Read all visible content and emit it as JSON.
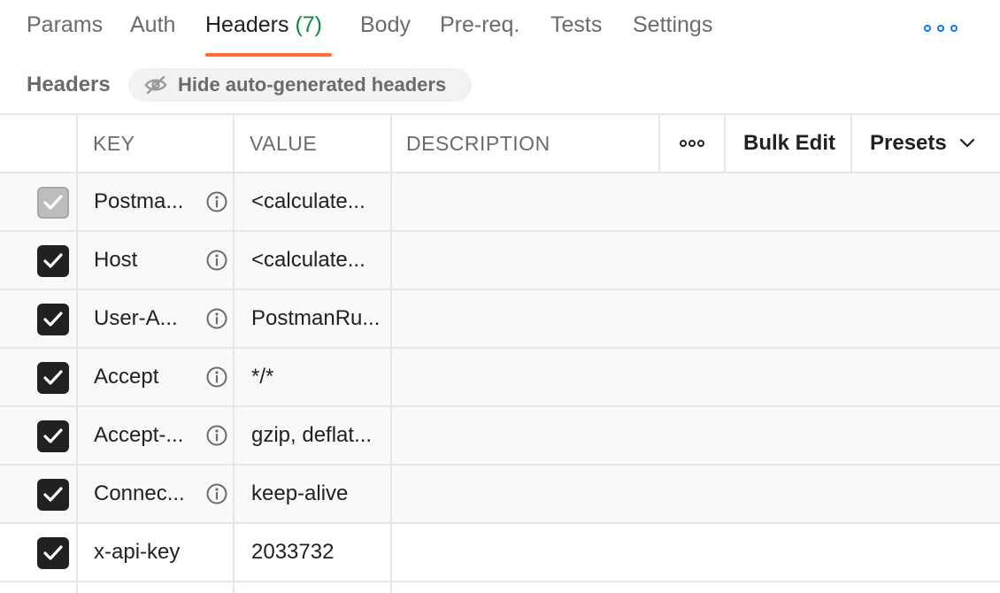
{
  "tabs": [
    {
      "label": "Params"
    },
    {
      "label": "Auth"
    },
    {
      "label": "Headers",
      "count": "(7)"
    },
    {
      "label": "Body"
    },
    {
      "label": "Pre-req."
    },
    {
      "label": "Tests"
    },
    {
      "label": "Settings"
    }
  ],
  "active_tab": "Headers",
  "accent_color": "#ff6c37",
  "more_icon": "more-horizontal-icon",
  "subheader": {
    "title": "Headers",
    "hide_button_label": "Hide auto-generated headers",
    "hide_icon": "eye-off-icon"
  },
  "table": {
    "columns": {
      "key": "KEY",
      "value": "VALUE",
      "description": "DESCRIPTION"
    },
    "bulk_edit_label": "Bulk Edit",
    "presets_label": "Presets",
    "rows": [
      {
        "key": "Postma...",
        "value": "<calculate...",
        "checked": true,
        "disabled": true,
        "info": true
      },
      {
        "key": "Host",
        "value": "<calculate...",
        "checked": true,
        "disabled": false,
        "info": true
      },
      {
        "key": "User-A...",
        "value": "PostmanRu...",
        "checked": true,
        "disabled": false,
        "info": true
      },
      {
        "key": "Accept",
        "value": "*/*",
        "checked": true,
        "disabled": false,
        "info": true
      },
      {
        "key": "Accept-...",
        "value": "gzip, deflat...",
        "checked": true,
        "disabled": false,
        "info": true
      },
      {
        "key": "Connec...",
        "value": "keep-alive",
        "checked": true,
        "disabled": false,
        "info": true
      },
      {
        "key": "x-api-key",
        "value": "2033732",
        "checked": true,
        "disabled": false,
        "info": false
      }
    ]
  }
}
